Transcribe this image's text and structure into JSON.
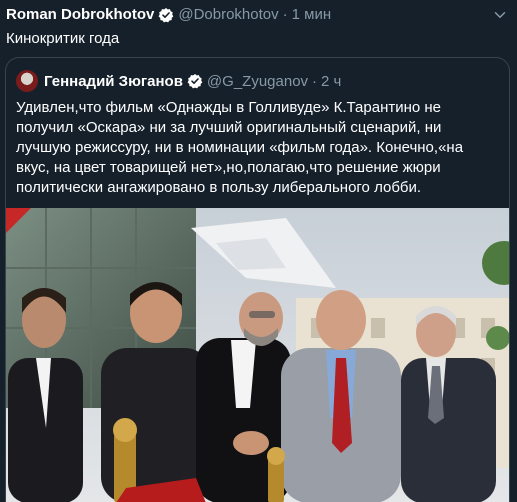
{
  "tweet": {
    "author_name": "Roman Dobrokhotov",
    "author_handle": "@Dobrokhotov",
    "separator": "·",
    "time": "1 мин",
    "text": "Кинокритик года",
    "verified_icon": "verified-badge-icon",
    "menu_icon": "chevron-down-icon"
  },
  "quoted": {
    "author_name": "Геннадий Зюганов",
    "author_handle": "@G_Zyuganov",
    "separator": "·",
    "time": "2 ч",
    "text": "Удивлен,что фильм «Однажды в Голливуде» К.Тарантино не получил «Оскара» ни за лучший оригинальный сценарий, ни лучшую режиссуру, ни в номинации «фильм года». Конечно,«на вкус, на цвет товарищей нет»,но,полагаю,что решение жюри политически ангажировано в пользу либерального лобби.",
    "verified_icon": "verified-badge-icon",
    "photo": "group-photo"
  },
  "colors": {
    "background": "#15202b",
    "secondary_text": "#8899a6",
    "border": "#38444d",
    "verified": "#1da1f2"
  }
}
